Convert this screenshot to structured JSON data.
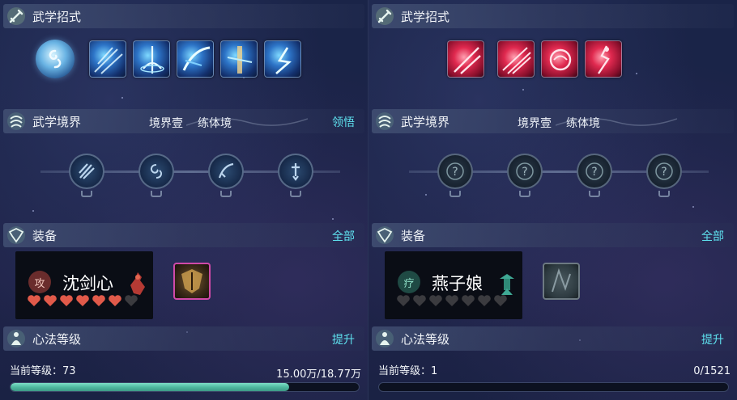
{
  "panels": [
    {
      "skills_title": "武学招式",
      "skill_icons": [
        "medal-icon",
        "skill-1-icon",
        "skill-2-icon",
        "skill-3-icon",
        "skill-4-icon",
        "skill-5-icon"
      ],
      "realm_title": "武学境界",
      "realm_level": "境界壹",
      "realm_name": "练体境",
      "realm_action": "领悟",
      "equip_title": "装备",
      "equip_action": "全部",
      "equip_badge": "攻",
      "equip_name": "沈剑心",
      "hearts_filled": 6,
      "hearts_total": 7,
      "heart_color": "#e15a4a",
      "method_title": "心法等级",
      "method_action": "提升",
      "level_label": "当前等级：73",
      "progress_text": "15.00万/18.77万",
      "progress": 0.8,
      "progress_color": "#4fb9a0"
    },
    {
      "skills_title": "武学招式",
      "skill_icons": [
        "skill-1-icon",
        "skill-2-icon",
        "skill-3-icon",
        "skill-4-icon"
      ],
      "realm_title": "武学境界",
      "realm_level": "境界壹",
      "realm_name": "练体境",
      "equip_title": "装备",
      "equip_action": "全部",
      "equip_badge": "疗",
      "equip_name": "燕子娘",
      "hearts_filled": 0,
      "hearts_total": 7,
      "method_title": "心法等级",
      "method_action": "提升",
      "level_label": "当前等级：1",
      "progress_text": "0/1521",
      "progress": 0
    }
  ],
  "accent_color": "#5fe3f0"
}
